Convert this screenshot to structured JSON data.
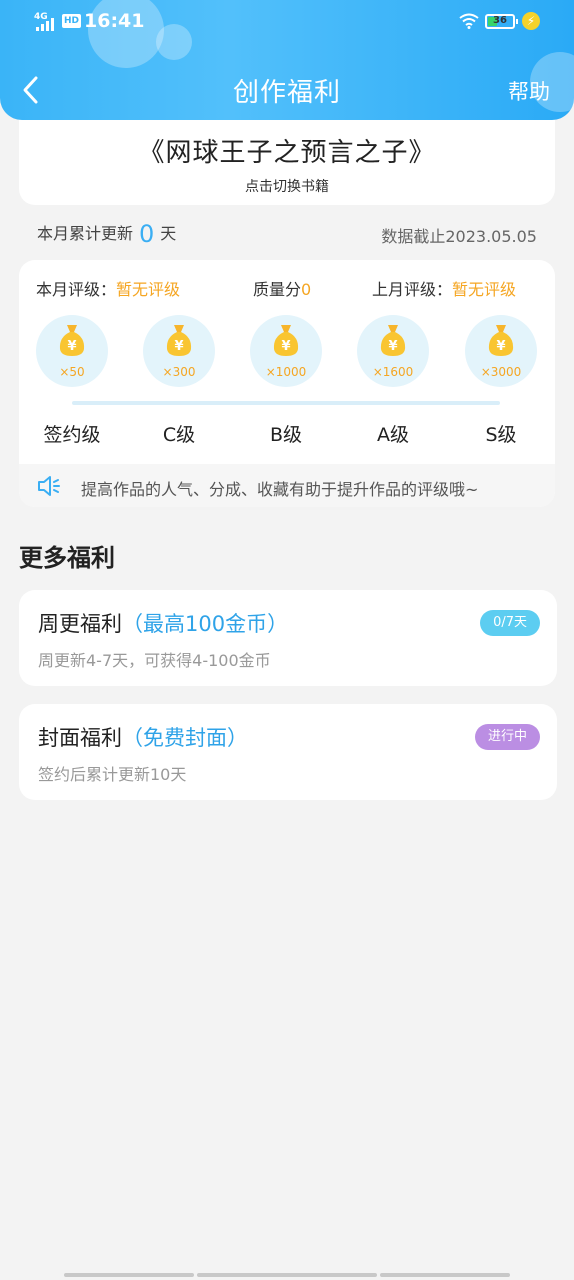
{
  "status_bar": {
    "network": "4G",
    "hd_badge": "HD",
    "time": "16:41",
    "battery_level": "36",
    "charging_icon": "lightning-icon",
    "battery_color": "#38d46a"
  },
  "header": {
    "title": "创作福利",
    "help_label": "帮助",
    "back_icon": "back-arrow-icon",
    "gradient_color": "#3ab4f7"
  },
  "book": {
    "title": "《网球王子之预言之子》",
    "switch_label": "点击切换书籍"
  },
  "update_stats": {
    "label": "本月累计更新",
    "days": "0",
    "unit": "天",
    "deadline": "数据截止2023.05.05"
  },
  "rating": {
    "this_month_label": "本月评级：",
    "this_month_value": "暂无评级",
    "quality_label": "质量分",
    "quality_value": "0",
    "last_month_label": "上月评级：",
    "last_month_value": "暂无评级",
    "progress": 0,
    "levels": [
      {
        "reward": "×50",
        "name": "签约级"
      },
      {
        "reward": "×300",
        "name": "C级"
      },
      {
        "reward": "×1000",
        "name": "B级"
      },
      {
        "reward": "×1600",
        "name": "A级"
      },
      {
        "reward": "×3000",
        "name": "S级"
      }
    ],
    "tip_icon": "speaker-icon",
    "tip": "提高作品的人气、分成、收藏有助于提升作品的评级哦~",
    "accent_color": "#f5a623"
  },
  "more": {
    "title": "更多福利",
    "items": [
      {
        "name": "周更福利",
        "highlight": "（最高100金币）",
        "desc": "周更新4-7天，可获得4-100金币",
        "badge": "0/7天",
        "badge_color": "#5ccdf1"
      },
      {
        "name": "封面福利",
        "highlight": "（免费封面）",
        "desc": "签约后累计更新10天",
        "badge": "进行中",
        "badge_color": "#bb8ee3"
      }
    ]
  }
}
